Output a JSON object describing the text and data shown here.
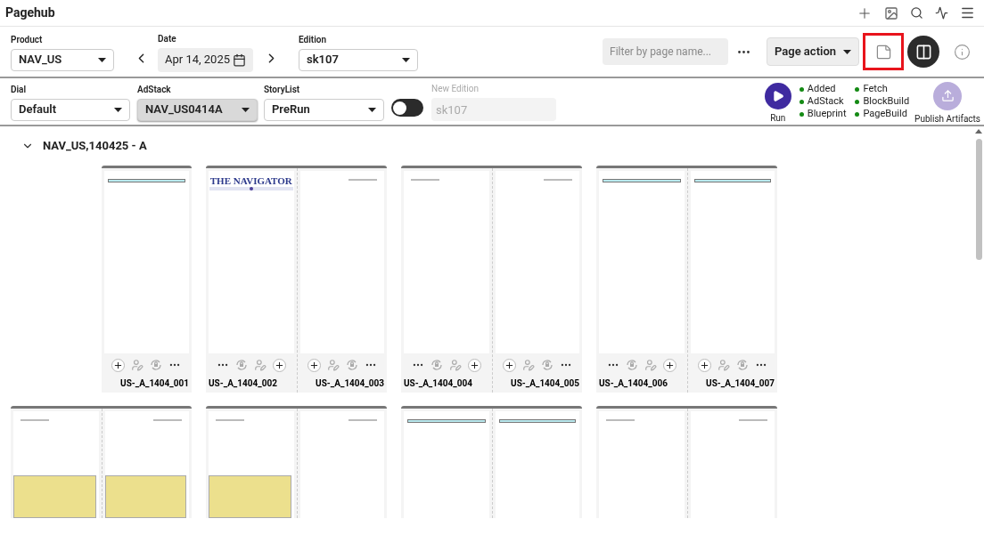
{
  "app": {
    "title": "Pagehub"
  },
  "toolbar": {
    "product": {
      "label": "Product",
      "value": "NAV_US",
      "focused": false
    },
    "date": {
      "label": "Date",
      "value": "Apr 14, 2025"
    },
    "edition": {
      "label": "Edition",
      "value": "sk107",
      "focused": false
    },
    "filter": {
      "placeholder": "Filter by page name..."
    },
    "page_action": "Page action",
    "note_highlighted": true
  },
  "controls": {
    "dial": {
      "label": "Dial",
      "value": "Default",
      "focused": false
    },
    "adstack": {
      "label": "AdStack",
      "value": "NAV_US0414A",
      "focused": true
    },
    "storylist": {
      "label": "StoryList",
      "value": "PreRun",
      "focused": false
    },
    "toggle": {
      "on": false
    },
    "new_edition": {
      "label": "New Edition",
      "value": "sk107",
      "disabled": true
    },
    "run": "Run",
    "status": [
      {
        "label": "Added",
        "done": true
      },
      {
        "label": "AdStack",
        "done": true
      },
      {
        "label": "Blueprint",
        "done": true
      },
      {
        "label": "Fetch",
        "done": true
      },
      {
        "label": "BlockBuild",
        "done": true
      },
      {
        "label": "PageBuild",
        "done": true
      }
    ],
    "publish": "Publish Artifacts"
  },
  "section": {
    "title": "NAV_US,140425 - A",
    "expanded": true,
    "rows": [
      [
        {
          "single": true,
          "pages": [
            {
              "label": "US-_A_1404_001",
              "kind": "bar",
              "ad": false
            }
          ]
        },
        {
          "pages": [
            {
              "label": "US-_A_1404_002",
              "kind": "masthead",
              "masthead": "THE NAVIGATOR",
              "ad": false
            },
            {
              "label": "US-_A_1404_003",
              "kind": "folio",
              "ad": false
            }
          ]
        },
        {
          "pages": [
            {
              "label": "US-_A_1404_004",
              "kind": "folio",
              "ad": false
            },
            {
              "label": "US-_A_1404_005",
              "kind": "folio",
              "ad": false
            }
          ]
        },
        {
          "pages": [
            {
              "label": "US-_A_1404_006",
              "kind": "bar",
              "ad": false
            },
            {
              "label": "US-_A_1404_007",
              "kind": "bar",
              "ad": false
            }
          ]
        }
      ],
      [
        {
          "pages": [
            {
              "kind": "folio",
              "ad": true
            },
            {
              "kind": "folio",
              "ad": true
            }
          ]
        },
        {
          "pages": [
            {
              "kind": "folio",
              "ad": true
            },
            {
              "kind": "folio",
              "ad": false
            }
          ]
        },
        {
          "pages": [
            {
              "kind": "bar",
              "ad": false
            },
            {
              "kind": "bar",
              "ad": false
            }
          ]
        },
        {
          "pages": [
            {
              "kind": "folio",
              "ad": false
            },
            {
              "kind": "folio",
              "ad": false
            }
          ]
        }
      ]
    ]
  }
}
